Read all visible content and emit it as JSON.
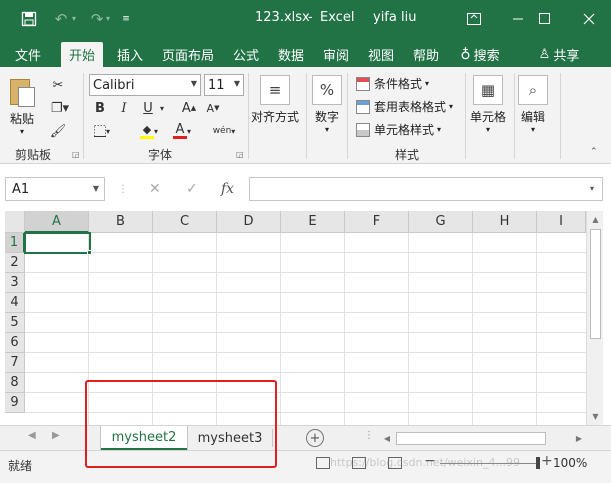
{
  "titlebar": {
    "filename": "123.xlsx",
    "separator": "-",
    "app": "Excel",
    "user": "yifa liu",
    "icons": [
      "save-icon",
      "undo-icon",
      "redo-icon",
      "customize-quick-access-icon",
      "ribbon-display-options-icon",
      "minimize-icon",
      "maximize-icon",
      "close-icon"
    ]
  },
  "tabs": [
    "文件",
    "开始",
    "插入",
    "页面布局",
    "公式",
    "数据",
    "审阅",
    "视图",
    "帮助",
    "搜索",
    "共享"
  ],
  "active_tab": "开始",
  "ribbon": {
    "clipboard": {
      "paste": "粘贴",
      "group": "剪贴板"
    },
    "font": {
      "name": "Calibri",
      "size": "11",
      "bold": "B",
      "italic": "I",
      "underline": "U",
      "grow": "A",
      "shrink": "A",
      "color": "A",
      "pinyin": "wén",
      "group": "字体"
    },
    "alignment": {
      "label": "对齐方式"
    },
    "number": {
      "label": "数字",
      "symbol": "%"
    },
    "styles": {
      "conditional": "条件格式",
      "table": "套用表格格式",
      "cell": "单元格样式",
      "group": "样式"
    },
    "cells": {
      "label": "单元格"
    },
    "editing": {
      "label": "编辑"
    }
  },
  "formula_bar": {
    "name_box": "A1",
    "fx": "fx",
    "formula": ""
  },
  "columns": [
    "A",
    "B",
    "C",
    "D",
    "E",
    "F",
    "G",
    "H",
    "I"
  ],
  "rows": [
    "1",
    "2",
    "3",
    "4",
    "5",
    "6",
    "7",
    "8",
    "9"
  ],
  "selected_cell": "A1",
  "sheets": [
    "mysheet2",
    "mysheet3"
  ],
  "active_sheet": "mysheet2",
  "status": {
    "ready": "就绪",
    "zoom": "100%"
  },
  "watermark": "https://blog.csdn.net/weixin_4...99",
  "colors": {
    "accent": "#217346",
    "annotation": "#e02020"
  }
}
